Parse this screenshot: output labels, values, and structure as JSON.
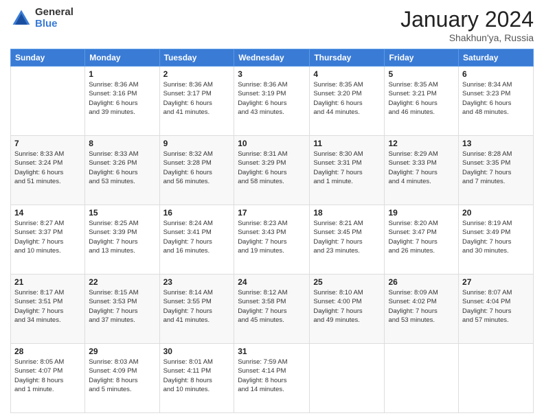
{
  "logo": {
    "general": "General",
    "blue": "Blue"
  },
  "title": {
    "month": "January 2024",
    "location": "Shakhun'ya, Russia"
  },
  "headers": [
    "Sunday",
    "Monday",
    "Tuesday",
    "Wednesday",
    "Thursday",
    "Friday",
    "Saturday"
  ],
  "weeks": [
    [
      {
        "day": "",
        "info": ""
      },
      {
        "day": "1",
        "info": "Sunrise: 8:36 AM\nSunset: 3:16 PM\nDaylight: 6 hours\nand 39 minutes."
      },
      {
        "day": "2",
        "info": "Sunrise: 8:36 AM\nSunset: 3:17 PM\nDaylight: 6 hours\nand 41 minutes."
      },
      {
        "day": "3",
        "info": "Sunrise: 8:36 AM\nSunset: 3:19 PM\nDaylight: 6 hours\nand 43 minutes."
      },
      {
        "day": "4",
        "info": "Sunrise: 8:35 AM\nSunset: 3:20 PM\nDaylight: 6 hours\nand 44 minutes."
      },
      {
        "day": "5",
        "info": "Sunrise: 8:35 AM\nSunset: 3:21 PM\nDaylight: 6 hours\nand 46 minutes."
      },
      {
        "day": "6",
        "info": "Sunrise: 8:34 AM\nSunset: 3:23 PM\nDaylight: 6 hours\nand 48 minutes."
      }
    ],
    [
      {
        "day": "7",
        "info": "Sunrise: 8:33 AM\nSunset: 3:24 PM\nDaylight: 6 hours\nand 51 minutes."
      },
      {
        "day": "8",
        "info": "Sunrise: 8:33 AM\nSunset: 3:26 PM\nDaylight: 6 hours\nand 53 minutes."
      },
      {
        "day": "9",
        "info": "Sunrise: 8:32 AM\nSunset: 3:28 PM\nDaylight: 6 hours\nand 56 minutes."
      },
      {
        "day": "10",
        "info": "Sunrise: 8:31 AM\nSunset: 3:29 PM\nDaylight: 6 hours\nand 58 minutes."
      },
      {
        "day": "11",
        "info": "Sunrise: 8:30 AM\nSunset: 3:31 PM\nDaylight: 7 hours\nand 1 minute."
      },
      {
        "day": "12",
        "info": "Sunrise: 8:29 AM\nSunset: 3:33 PM\nDaylight: 7 hours\nand 4 minutes."
      },
      {
        "day": "13",
        "info": "Sunrise: 8:28 AM\nSunset: 3:35 PM\nDaylight: 7 hours\nand 7 minutes."
      }
    ],
    [
      {
        "day": "14",
        "info": "Sunrise: 8:27 AM\nSunset: 3:37 PM\nDaylight: 7 hours\nand 10 minutes."
      },
      {
        "day": "15",
        "info": "Sunrise: 8:25 AM\nSunset: 3:39 PM\nDaylight: 7 hours\nand 13 minutes."
      },
      {
        "day": "16",
        "info": "Sunrise: 8:24 AM\nSunset: 3:41 PM\nDaylight: 7 hours\nand 16 minutes."
      },
      {
        "day": "17",
        "info": "Sunrise: 8:23 AM\nSunset: 3:43 PM\nDaylight: 7 hours\nand 19 minutes."
      },
      {
        "day": "18",
        "info": "Sunrise: 8:21 AM\nSunset: 3:45 PM\nDaylight: 7 hours\nand 23 minutes."
      },
      {
        "day": "19",
        "info": "Sunrise: 8:20 AM\nSunset: 3:47 PM\nDaylight: 7 hours\nand 26 minutes."
      },
      {
        "day": "20",
        "info": "Sunrise: 8:19 AM\nSunset: 3:49 PM\nDaylight: 7 hours\nand 30 minutes."
      }
    ],
    [
      {
        "day": "21",
        "info": "Sunrise: 8:17 AM\nSunset: 3:51 PM\nDaylight: 7 hours\nand 34 minutes."
      },
      {
        "day": "22",
        "info": "Sunrise: 8:15 AM\nSunset: 3:53 PM\nDaylight: 7 hours\nand 37 minutes."
      },
      {
        "day": "23",
        "info": "Sunrise: 8:14 AM\nSunset: 3:55 PM\nDaylight: 7 hours\nand 41 minutes."
      },
      {
        "day": "24",
        "info": "Sunrise: 8:12 AM\nSunset: 3:58 PM\nDaylight: 7 hours\nand 45 minutes."
      },
      {
        "day": "25",
        "info": "Sunrise: 8:10 AM\nSunset: 4:00 PM\nDaylight: 7 hours\nand 49 minutes."
      },
      {
        "day": "26",
        "info": "Sunrise: 8:09 AM\nSunset: 4:02 PM\nDaylight: 7 hours\nand 53 minutes."
      },
      {
        "day": "27",
        "info": "Sunrise: 8:07 AM\nSunset: 4:04 PM\nDaylight: 7 hours\nand 57 minutes."
      }
    ],
    [
      {
        "day": "28",
        "info": "Sunrise: 8:05 AM\nSunset: 4:07 PM\nDaylight: 8 hours\nand 1 minute."
      },
      {
        "day": "29",
        "info": "Sunrise: 8:03 AM\nSunset: 4:09 PM\nDaylight: 8 hours\nand 5 minutes."
      },
      {
        "day": "30",
        "info": "Sunrise: 8:01 AM\nSunset: 4:11 PM\nDaylight: 8 hours\nand 10 minutes."
      },
      {
        "day": "31",
        "info": "Sunrise: 7:59 AM\nSunset: 4:14 PM\nDaylight: 8 hours\nand 14 minutes."
      },
      {
        "day": "",
        "info": ""
      },
      {
        "day": "",
        "info": ""
      },
      {
        "day": "",
        "info": ""
      }
    ]
  ]
}
